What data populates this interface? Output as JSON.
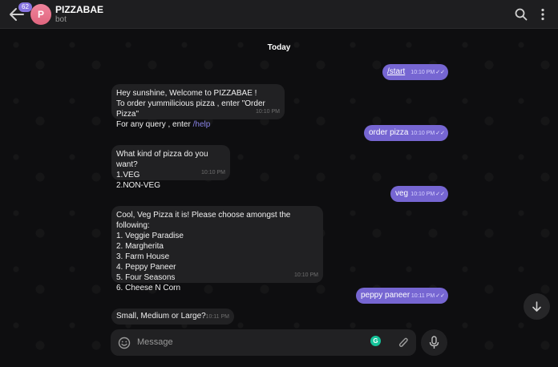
{
  "header": {
    "unread_count": "62",
    "avatar_letter": "P",
    "title": "PIZZABAE",
    "subtitle": "bot",
    "icons": [
      "back-arrow-icon",
      "search-icon",
      "more-vertical-icon"
    ]
  },
  "chat": {
    "date_label": "Today",
    "messages": [
      {
        "dir": "out",
        "text": "/start",
        "time": "10:10 PM"
      },
      {
        "dir": "in",
        "lines": [
          "Hey sunshine, Welcome to PIZZABAE !",
          "To order yummilicious pizza , enter \"Order Pizza\"",
          "For any query , enter "
        ],
        "link": "/help",
        "time": "10:10 PM"
      },
      {
        "dir": "out",
        "text": "order pizza",
        "time": "10:10 PM"
      },
      {
        "dir": "in",
        "lines": [
          "What kind of pizza do you want?",
          "1.VEG",
          "2.NON-VEG"
        ],
        "time": "10:10 PM"
      },
      {
        "dir": "out",
        "text": "veg",
        "time": "10:10 PM"
      },
      {
        "dir": "in",
        "lines": [
          "Cool, Veg Pizza it is! Please choose amongst the following:",
          "1. Veggie Paradise",
          "2. Margherita",
          "3. Farm House",
          "4. Peppy Paneer",
          "5. Four Seasons",
          "6. Cheese N Corn"
        ],
        "time": "10:10 PM"
      },
      {
        "dir": "out",
        "text": "peppy paneer",
        "time": "10:11 PM"
      },
      {
        "dir": "in",
        "lines": [
          "Small, Medium or Large?"
        ],
        "time": "10:11 PM"
      }
    ]
  },
  "composer": {
    "placeholder": "Message",
    "grammarly_letter": "G"
  },
  "colors": {
    "accent": "#8774e1",
    "outgoing_bubble": "#7666d2",
    "incoming_bubble": "#212123",
    "background": "#0e0e10"
  }
}
